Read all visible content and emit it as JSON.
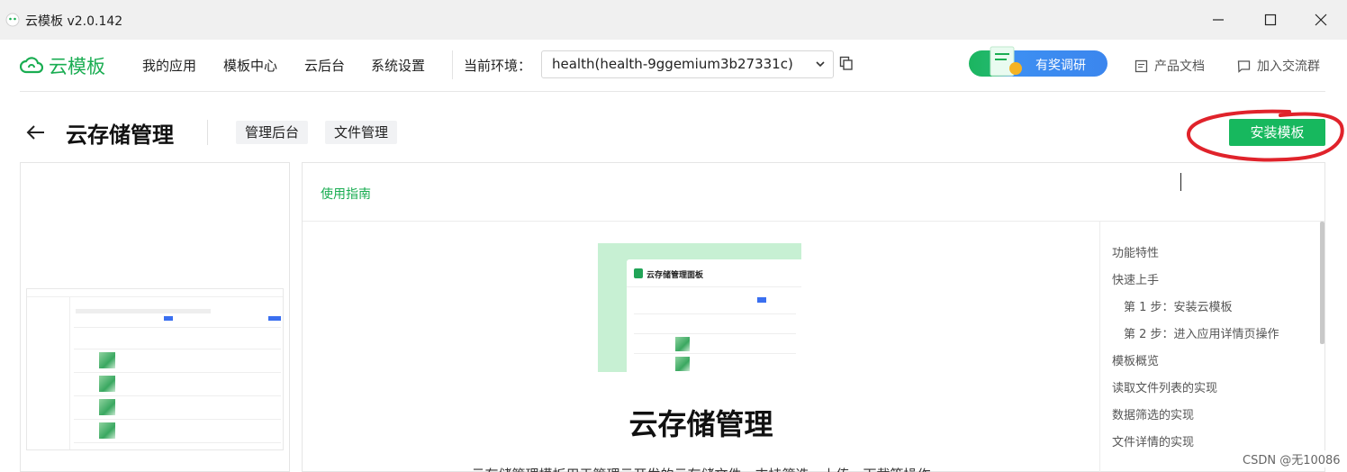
{
  "window": {
    "title": "云模板 v2.0.142"
  },
  "navbar": {
    "logo_text": "云模板",
    "items": [
      {
        "label": "我的应用"
      },
      {
        "label": "模板中心"
      },
      {
        "label": "云后台"
      },
      {
        "label": "系统设置"
      }
    ],
    "env_label": "当前环境：",
    "env_value": "health(health-9ggemium3b27331c)",
    "survey_label": "有奖调研",
    "docs_label": "产品文档",
    "group_label": "加入交流群"
  },
  "header": {
    "title": "云存储管理",
    "tags": [
      "管理后台",
      "文件管理"
    ],
    "install_label": "安装模板"
  },
  "doc": {
    "tab_label": "使用指南",
    "hero_caption": "云存储管理面板",
    "heading": "云存储管理",
    "description": "云存储管理模板用于管理云开发的云存储文件，支持筛选、上传、下载等操作",
    "toc": [
      {
        "label": "功能特性"
      },
      {
        "label": "快速上手"
      },
      {
        "label": "第 1 步：安装云模板"
      },
      {
        "label": "第 2 步：进入应用详情页操作"
      },
      {
        "label": "模板概览"
      },
      {
        "label": "读取文件列表的实现"
      },
      {
        "label": "数据筛选的实现"
      },
      {
        "label": "文件详情的实现"
      }
    ]
  },
  "watermark": "CSDN @无10086",
  "colors": {
    "brand_green": "#1aad52",
    "install_green": "#17b85e",
    "annotation_red": "#e0232b"
  }
}
